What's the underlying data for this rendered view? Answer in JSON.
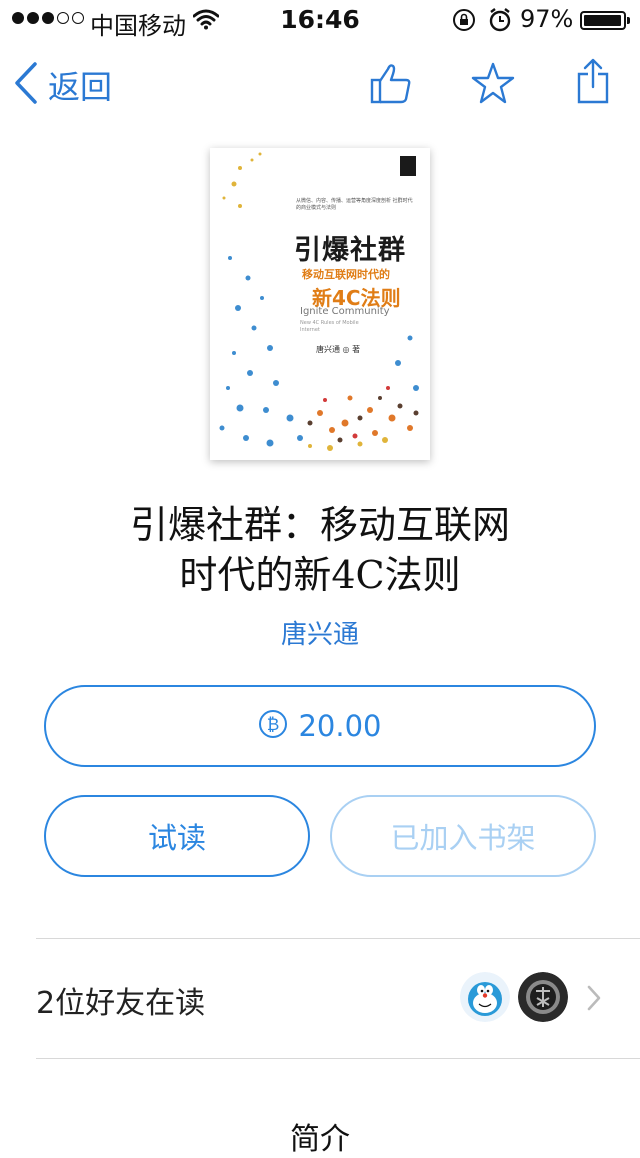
{
  "status_bar": {
    "carrier": "中国移动",
    "time": "16:46",
    "battery_percent": "97%",
    "signal_bars_filled": 3,
    "signal_bars_total": 5
  },
  "nav": {
    "back_label": "返回",
    "like_icon": "thumbs-up-icon",
    "favorite_icon": "star-icon",
    "share_icon": "share-icon",
    "accent_color": "#2b79d3"
  },
  "cover": {
    "tagline": "从微信、内容、传播、运营等角度深度剖析 社群时代的商业模式与法则",
    "title": "引爆社群",
    "subtitle_line1": "移动互联网时代的",
    "subtitle_line2": "新4C法则",
    "english_title": "Ignite Community",
    "english_sub": "New 4C Rules of Mobile Internet",
    "author": "唐兴通 ◎ 著"
  },
  "book": {
    "title_line1": "引爆社群：移动互联网",
    "title_line2": "时代的新4C法则",
    "author": "唐兴通"
  },
  "actions": {
    "price": "20.00",
    "price_icon": "bitcoin-coin-icon",
    "trial_label": "试读",
    "shelf_label": "已加入书架"
  },
  "friends": {
    "label": "2位好友在读",
    "avatars": [
      "doraemon-avatar",
      "dark-logo-avatar"
    ]
  },
  "intro": {
    "title": "简介"
  }
}
